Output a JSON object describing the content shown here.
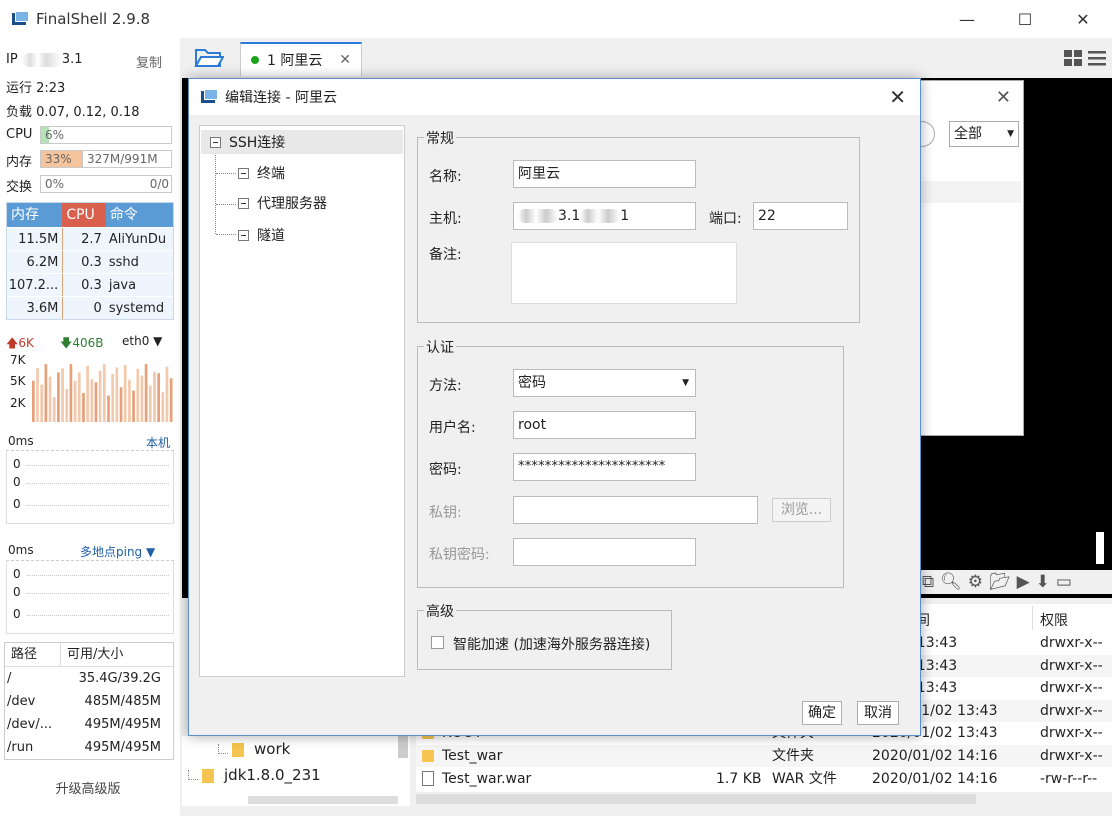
{
  "app": {
    "title": "FinalShell 2.9.8"
  },
  "window": {
    "minimize": "—",
    "maximize": "☐",
    "close": "✕"
  },
  "sidebar": {
    "ip_label": "IP",
    "ip_visible": "3.1",
    "copy": "复制",
    "uptime": "运行 2:23",
    "load": "负载 0.07, 0.12, 0.18",
    "cpu_label": "CPU",
    "cpu_value": "6%",
    "cpu_fraction": 0.06,
    "mem_label": "内存",
    "mem_value": "33%",
    "mem_fraction": 0.33,
    "mem_size": "327M/991M",
    "swap_label": "交换",
    "swap_value": "0%",
    "swap_size": "0/0",
    "proc_headers": [
      "内存",
      "CPU",
      "命令"
    ],
    "processes": [
      {
        "mem": "11.5M",
        "cpu": "2.7",
        "cmd": "AliYunDu"
      },
      {
        "mem": "6.2M",
        "cpu": "0.3",
        "cmd": "sshd"
      },
      {
        "mem": "107.2...",
        "cpu": "0.3",
        "cmd": "java"
      },
      {
        "mem": "3.6M",
        "cpu": "0",
        "cmd": "systemd"
      }
    ],
    "net_up": "6K",
    "net_down": "406B",
    "net_iface": "eth0",
    "net_ticks": [
      "7K",
      "5K",
      "2K"
    ],
    "net_bars": [
      5,
      6.5,
      4.5,
      7,
      5.5,
      3,
      6,
      6.5,
      4,
      7,
      5,
      6,
      3.5,
      6.8,
      5.2,
      4.8,
      6.2,
      7,
      3.2,
      5.8,
      6.6,
      4.2,
      6.9,
      5.1,
      3.8,
      6.4,
      5.6,
      7,
      4.4,
      6.1,
      5.9,
      3.6,
      6.7,
      5.3
    ],
    "ping1_ms": "0ms",
    "ping1_target": "本机",
    "ping1_ticks": [
      "0",
      "0",
      "0"
    ],
    "ping2_ms": "0ms",
    "ping2_target": "多地点ping",
    "ping2_ticks": [
      "0",
      "0",
      "0"
    ],
    "disk_headers": [
      "路径",
      "可用/大小"
    ],
    "disks": [
      {
        "path": "/",
        "size": "35.4G/39.2G"
      },
      {
        "path": "/dev",
        "size": "485M/485M"
      },
      {
        "path": "/dev/...",
        "size": "495M/495M"
      },
      {
        "path": "/run",
        "size": "495M/495M"
      }
    ],
    "upgrade": "升级高级版"
  },
  "tabs": [
    {
      "label": "1 阿里云",
      "close": "✕"
    }
  ],
  "bg_popup": {
    "close": "✕",
    "filter": "全部"
  },
  "files": {
    "headers": {
      "time": "间",
      "perm": "权限"
    },
    "rows": [
      {
        "name": "",
        "size": "",
        "type": "",
        "date": "01/02 13:43",
        "perm": "drwxr-x--",
        "kind": "folder"
      },
      {
        "name": "",
        "size": "",
        "type": "",
        "date": "01/02 13:43",
        "perm": "drwxr-x--",
        "kind": "folder"
      },
      {
        "name": "",
        "size": "",
        "type": "",
        "date": "01/02 13:43",
        "perm": "drwxr-x--",
        "kind": "folder"
      },
      {
        "name": "",
        "size": "",
        "type": "",
        "date": "2020/01/02 13:43",
        "perm": "drwxr-x--",
        "kind": "folder"
      },
      {
        "name": "ROOT",
        "size": "",
        "type": "文件夹",
        "date": "2020/01/02 13:43",
        "perm": "drwxr-x--",
        "kind": "folder"
      },
      {
        "name": "Test_war",
        "size": "",
        "type": "文件夹",
        "date": "2020/01/02 14:16",
        "perm": "drwxr-x--",
        "kind": "folder"
      },
      {
        "name": "Test_war.war",
        "size": "1.7 KB",
        "type": "WAR 文件",
        "date": "2020/01/02 14:16",
        "perm": "-rw-r--r--",
        "kind": "file"
      }
    ]
  },
  "tree": {
    "items": [
      "work",
      "jdk1.8.0_231"
    ]
  },
  "dialog": {
    "title": "编辑连接 - 阿里云",
    "close": "✕",
    "nav": [
      "SSH连接",
      "终端",
      "代理服务器",
      "隧道"
    ],
    "general": {
      "legend": "常规",
      "name_label": "名称:",
      "name_value": "阿里云",
      "host_label": "主机:",
      "host_visible": "3.1",
      "host_tail": "1",
      "port_label": "端口:",
      "port_value": "22",
      "note_label": "备注:"
    },
    "auth": {
      "legend": "认证",
      "method_label": "方法:",
      "method_value": "密码",
      "user_label": "用户名:",
      "user_value": "root",
      "pass_label": "密码:",
      "pass_value": "**********************",
      "key_label": "私钥:",
      "browse": "浏览...",
      "keypass_label": "私钥密码:"
    },
    "advanced": {
      "legend": "高级",
      "accel": "智能加速 (加速海外服务器连接)"
    },
    "ok": "确定",
    "cancel": "取消"
  }
}
